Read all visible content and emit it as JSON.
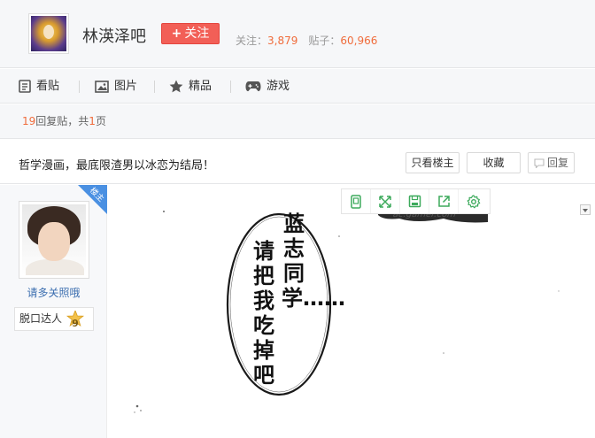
{
  "forum": {
    "name": "林渶泽吧",
    "follow_label": "关注",
    "follow_plus": "+",
    "stats": {
      "follow_label": "关注：",
      "follow_count": "3,879",
      "post_label": "贴子：",
      "post_count": "60,966"
    }
  },
  "nav": {
    "items": [
      {
        "label": "看贴",
        "icon": "document-icon"
      },
      {
        "label": "图片",
        "icon": "image-icon"
      },
      {
        "label": "精品",
        "icon": "star-icon"
      },
      {
        "label": "游戏",
        "icon": "gamepad-icon"
      }
    ]
  },
  "reply_summary": {
    "count": "19",
    "text1": "回复贴，共",
    "pages": "1",
    "text2": "页"
  },
  "thread": {
    "title": "哲学漫画，最底限渣男以冰恋为结局！",
    "only_op_label": "只看楼主",
    "collect_label": "收藏",
    "reply_label": "回复"
  },
  "author": {
    "op_badge": "楼主",
    "name": "请多关照哦",
    "title_badge": "脱口达人",
    "level": "9"
  },
  "post": {
    "speech_col1": "蓝志同学……",
    "speech_col2": "请把我吃掉吧",
    "watermark": "ac.gamer.com",
    "toolbar_icons": [
      "view-original-icon",
      "fullscreen-icon",
      "save-icon",
      "share-icon",
      "settings-icon"
    ]
  },
  "colors": {
    "accent": "#f25f57",
    "number": "#f06c3c",
    "link": "#3d6fb0",
    "toolbar": "#3daa5c",
    "op_badge": "#4a90e2"
  }
}
